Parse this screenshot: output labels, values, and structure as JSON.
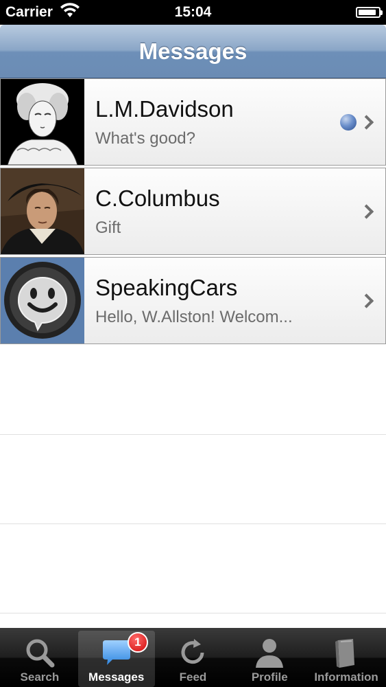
{
  "status_bar": {
    "carrier": "Carrier",
    "time": "15:04",
    "battery_level": 0.9
  },
  "nav": {
    "title": "Messages"
  },
  "messages": [
    {
      "name": "L.M.Davidson",
      "preview": "What's good?",
      "unread": true,
      "avatar": "portrait-woman-engraving"
    },
    {
      "name": "C.Columbus",
      "preview": "Gift",
      "unread": false,
      "avatar": "portrait-columbus-painting"
    },
    {
      "name": "SpeakingCars",
      "preview": "Hello, W.Allston! Welcom...",
      "unread": false,
      "avatar": "smiley-chat-bubble"
    }
  ],
  "tab_bar": {
    "tabs": [
      {
        "label": "Search",
        "icon": "search-icon",
        "active": false
      },
      {
        "label": "Messages",
        "icon": "chat-bubble-icon",
        "active": true,
        "badge": "1"
      },
      {
        "label": "Feed",
        "icon": "refresh-icon",
        "active": false
      },
      {
        "label": "Profile",
        "icon": "person-icon",
        "active": false
      },
      {
        "label": "Information",
        "icon": "book-icon",
        "active": false
      }
    ]
  }
}
